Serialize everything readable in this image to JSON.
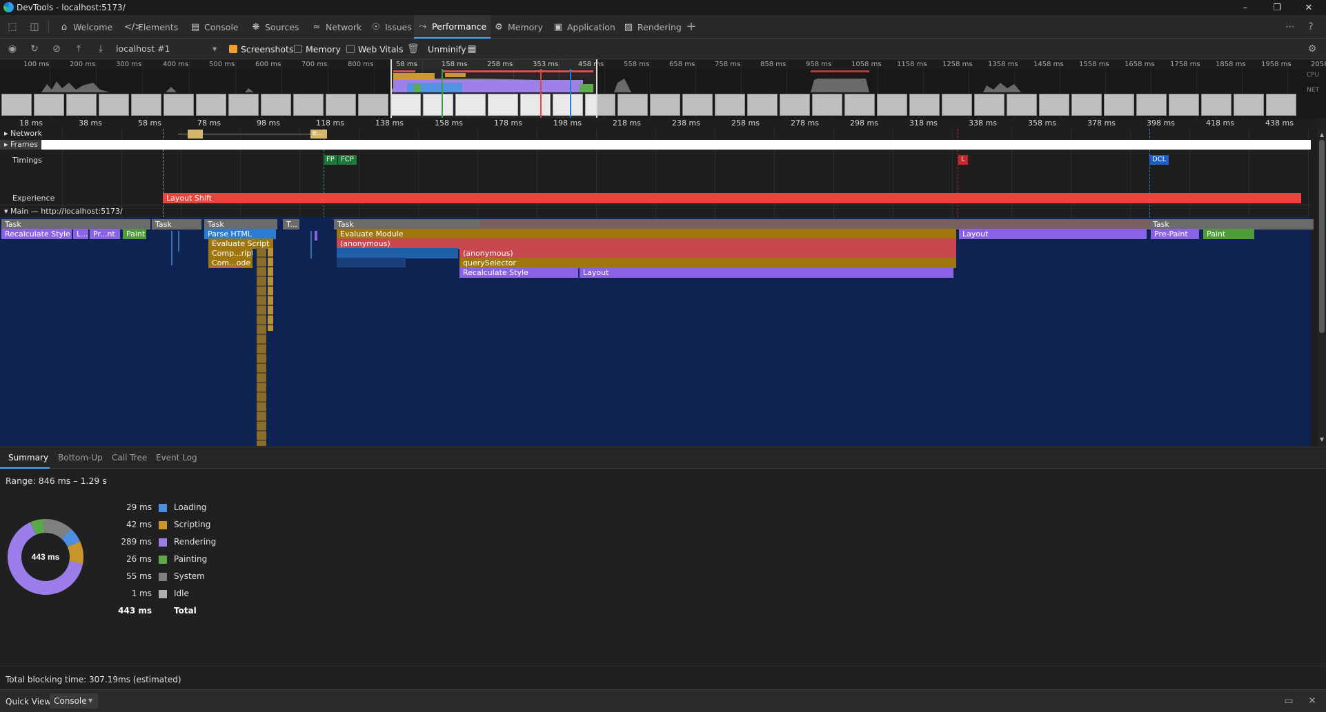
{
  "window": {
    "title": "DevTools - localhost:5173/"
  },
  "tabs": [
    {
      "label": "Welcome",
      "icon": "home-icon"
    },
    {
      "label": "Elements",
      "icon": "code-icon"
    },
    {
      "label": "Console",
      "icon": "console-icon"
    },
    {
      "label": "Sources",
      "icon": "bug-icon"
    },
    {
      "label": "Network",
      "icon": "wifi-icon"
    },
    {
      "label": "Issues",
      "icon": "issues-icon"
    },
    {
      "label": "Performance",
      "icon": "performance-icon",
      "active": true
    },
    {
      "label": "Memory",
      "icon": "memory-icon"
    },
    {
      "label": "Application",
      "icon": "application-icon"
    },
    {
      "label": "Rendering",
      "icon": "rendering-icon"
    }
  ],
  "toolbar": {
    "profile_select": "localhost #1",
    "screenshots_label": "Screenshots",
    "screenshots_checked": true,
    "memory_label": "Memory",
    "webvitals_label": "Web Vitals",
    "unminify_label": "Unminify"
  },
  "overview": {
    "ticks": [
      "100 ms",
      "200 ms",
      "300 ms",
      "400 ms",
      "500 ms",
      "600 ms",
      "700 ms",
      "800 ms",
      "58 ms",
      "158 ms",
      "258 ms",
      "353 ms",
      "458 ms",
      "558 ms",
      "658 ms",
      "758 ms",
      "858 ms",
      "958 ms",
      "1058 ms",
      "1158 ms",
      "1258 ms",
      "1358 ms",
      "1458 ms",
      "1558 ms",
      "1658 ms",
      "1758 ms",
      "1858 ms",
      "1958 ms",
      "2058"
    ],
    "cpu_label": "CPU",
    "net_label": "NET"
  },
  "ruler": {
    "ticks": [
      "18 ms",
      "38 ms",
      "58 ms",
      "78 ms",
      "98 ms",
      "118 ms",
      "138 ms",
      "158 ms",
      "178 ms",
      "198 ms",
      "218 ms",
      "238 ms",
      "258 ms",
      "278 ms",
      "298 ms",
      "318 ms",
      "338 ms",
      "358 ms",
      "378 ms",
      "398 ms",
      "418 ms",
      "438 ms"
    ]
  },
  "tracks": {
    "network": "Network",
    "frames": "Frames",
    "timings": "Timings",
    "experience": "Experience",
    "main": "Main — http://localhost:5173/"
  },
  "network_bar": "e...",
  "marks": {
    "fp": "FP",
    "fcp": "FCP",
    "l": "L",
    "dcl": "DCL"
  },
  "layout_shift": "Layout Shift",
  "flame": {
    "task": "Task",
    "task_short": "T...",
    "recalc": "Recalculate Style",
    "l_short": "L...",
    "pr_nt": "Pr...nt",
    "paint": "Paint",
    "parse_html": "Parse HTML",
    "evaluate_script": "Evaluate Script",
    "comp_ript": "Comp...ript",
    "com_ode": "Com...ode",
    "evaluate_module": "Evaluate Module",
    "anonymous": "(anonymous)",
    "query_selector": "querySelector",
    "layout": "Layout",
    "pre_paint": "Pre-Paint"
  },
  "bottom_tabs": [
    "Summary",
    "Bottom-Up",
    "Call Tree",
    "Event Log"
  ],
  "summary": {
    "range": "Range: 846 ms – 1.29 s",
    "total_center": "443 ms",
    "rows": [
      {
        "value": "29 ms",
        "label": "Loading",
        "color": "#4c8fe0",
        "ms": 29
      },
      {
        "value": "42 ms",
        "label": "Scripting",
        "color": "#c9952a",
        "ms": 42
      },
      {
        "value": "289 ms",
        "label": "Rendering",
        "color": "#9b7ce8",
        "ms": 289
      },
      {
        "value": "26 ms",
        "label": "Painting",
        "color": "#5aa84a",
        "ms": 26
      },
      {
        "value": "55 ms",
        "label": "System",
        "color": "#808080",
        "ms": 55
      },
      {
        "value": "1 ms",
        "label": "Idle",
        "color": "#b0b0b0",
        "ms": 1
      }
    ],
    "total_value": "443 ms",
    "total_label": "Total"
  },
  "status": {
    "blocking": "Total blocking time: 307.19ms (estimated)"
  },
  "quickview": {
    "label": "Quick View:",
    "selected": "Console"
  }
}
